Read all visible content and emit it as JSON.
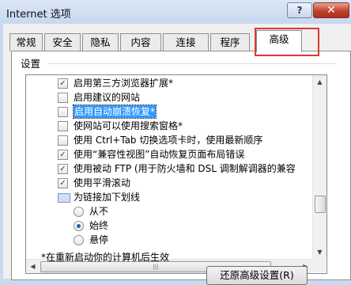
{
  "window": {
    "title": "Internet 选项",
    "help_label": "?",
    "close_label": "✕"
  },
  "tabs": [
    {
      "label": "常规"
    },
    {
      "label": "安全"
    },
    {
      "label": "隐私"
    },
    {
      "label": "内容"
    },
    {
      "label": "连接"
    },
    {
      "label": "程序"
    },
    {
      "label": "高级",
      "active": true
    }
  ],
  "settings": {
    "group_label": "设置",
    "items": [
      {
        "label": "启用第三方浏览器扩展*",
        "checked": true
      },
      {
        "label": "启用建议的网站",
        "checked": false
      },
      {
        "label": "启用自动崩溃恢复*",
        "checked": false,
        "selected": true
      },
      {
        "label": "使网站可以使用搜索窗格*",
        "checked": false
      },
      {
        "label": "使用 Ctrl+Tab 切换选项卡时，使用最新顺序",
        "checked": false
      },
      {
        "label": "使用“兼容性视图”自动恢复页面布局错误",
        "checked": true
      },
      {
        "label": "使用被动 FTP (用于防火墙和 DSL 调制解调器的兼容",
        "checked": true
      },
      {
        "label": "使用平滑滚动",
        "checked": true
      },
      {
        "label": "为链接加下划线",
        "icon": "folder-icon"
      },
      {
        "label": "从不",
        "radio": true,
        "checked": false
      },
      {
        "label": "始终",
        "radio": true,
        "checked": true
      },
      {
        "label": "悬停",
        "radio": true,
        "checked": false
      }
    ]
  },
  "check_mark": "✓",
  "scroll": {
    "up": "▲",
    "down": "▼",
    "left": "◀",
    "right": "▶",
    "grip": "|||"
  },
  "footer": {
    "note": "*在重新启动你的计算机后生效",
    "restore_button": "还原高级设置(R)"
  },
  "colors": {
    "highlight_box": "#d83b32",
    "selection": "#3399ff"
  }
}
